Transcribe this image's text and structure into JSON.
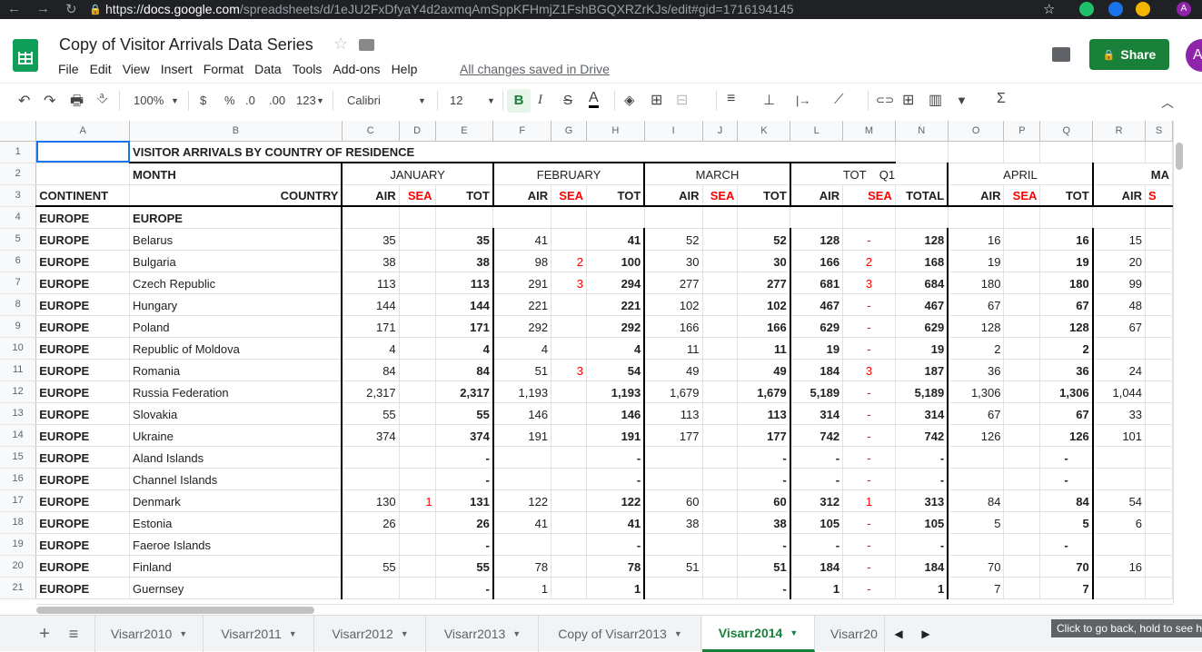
{
  "browser": {
    "url_scheme": "https://",
    "url_host": "docs.google.com",
    "url_path": "/spreadsheets/d/1eJU2FxDfyaY4d2axmqAmSppKFHmjZ1FshBGQXRZrKJs/edit#gid=1716194145",
    "back_icon": "←",
    "forward_icon": "→",
    "reload_icon": "↻",
    "lock_icon": "🔒",
    "star_icon": "☆",
    "profile": "A"
  },
  "app": {
    "title": "Copy of Visitor Arrivals Data Series",
    "star_icon": "☆",
    "menus": [
      "File",
      "Edit",
      "View",
      "Insert",
      "Format",
      "Data",
      "Tools",
      "Add-ons",
      "Help"
    ],
    "saved_status": "All changes saved in Drive",
    "share_label": "Share",
    "share_lock": "🔒",
    "avatar": "A"
  },
  "toolbar": {
    "undo": "↶",
    "redo": "↷",
    "print": "🖶",
    "paint": "⎀",
    "zoom": "100%",
    "currency": "$",
    "percent": "%",
    "dec_less": ".0",
    "dec_more": ".00",
    "format_more": "123",
    "font": "Calibri",
    "font_size": "12",
    "bold": "B",
    "italic": "I",
    "strike": "S",
    "text_color": "A",
    "fill": "◈",
    "borders": "⊞",
    "merge": "⊟",
    "align": "≡",
    "valign": "⊥",
    "wrap": "|→",
    "rotate": "⟋",
    "link": "⊂⊃",
    "comment": "⊞",
    "chart": "▥",
    "filter": "▼",
    "functions": "Σ",
    "collapse": "︿"
  },
  "columns": [
    "A",
    "B",
    "C",
    "D",
    "E",
    "F",
    "G",
    "H",
    "I",
    "J",
    "K",
    "L",
    "M",
    "N",
    "O",
    "P",
    "Q",
    "R",
    "S"
  ],
  "title_row": "VISITOR ARRIVALS BY COUNTRY OF RESIDENCE",
  "month_row": {
    "month": "MONTH",
    "jan": "JANUARY",
    "feb": "FEBRUARY",
    "mar": "MARCH",
    "q1": "TOT    Q1",
    "apr": "APRIL",
    "may": "MA"
  },
  "header_row": {
    "continent": "CONTINENT",
    "country": "COUNTRY",
    "air": "AIR",
    "sea": "SEA",
    "tot": "TOT",
    "total": "TOTAL",
    "sea_partial": "S"
  },
  "row4": {
    "continent": "EUROPE",
    "country": "EUROPE"
  },
  "rows": [
    [
      "EUROPE",
      "Belarus",
      "35",
      "",
      "35",
      "41",
      "",
      "41",
      "52",
      "",
      "52",
      "128",
      "-",
      "128",
      "16",
      "",
      "16",
      "15"
    ],
    [
      "EUROPE",
      "Bulgaria",
      "38",
      "",
      "38",
      "98",
      "2",
      "100",
      "30",
      "",
      "30",
      "166",
      "2",
      "168",
      "19",
      "",
      "19",
      "20"
    ],
    [
      "EUROPE",
      "Czech Republic",
      "113",
      "",
      "113",
      "291",
      "3",
      "294",
      "277",
      "",
      "277",
      "681",
      "3",
      "684",
      "180",
      "",
      "180",
      "99"
    ],
    [
      "EUROPE",
      "Hungary",
      "144",
      "",
      "144",
      "221",
      "",
      "221",
      "102",
      "",
      "102",
      "467",
      "-",
      "467",
      "67",
      "",
      "67",
      "48"
    ],
    [
      "EUROPE",
      "Poland",
      "171",
      "",
      "171",
      "292",
      "",
      "292",
      "166",
      "",
      "166",
      "629",
      "-",
      "629",
      "128",
      "",
      "128",
      "67"
    ],
    [
      "EUROPE",
      "Republic of Moldova",
      "4",
      "",
      "4",
      "4",
      "",
      "4",
      "11",
      "",
      "11",
      "19",
      "-",
      "19",
      "2",
      "",
      "2",
      ""
    ],
    [
      "EUROPE",
      "Romania",
      "84",
      "",
      "84",
      "51",
      "3",
      "54",
      "49",
      "",
      "49",
      "184",
      "3",
      "187",
      "36",
      "",
      "36",
      "24"
    ],
    [
      "EUROPE",
      "Russia Federation",
      "2,317",
      "",
      "2,317",
      "1,193",
      "",
      "1,193",
      "1,679",
      "",
      "1,679",
      "5,189",
      "-",
      "5,189",
      "1,306",
      "",
      "1,306",
      "1,044"
    ],
    [
      "EUROPE",
      "Slovakia",
      "55",
      "",
      "55",
      "146",
      "",
      "146",
      "113",
      "",
      "113",
      "314",
      "-",
      "314",
      "67",
      "",
      "67",
      "33"
    ],
    [
      "EUROPE",
      "Ukraine",
      "374",
      "",
      "374",
      "191",
      "",
      "191",
      "177",
      "",
      "177",
      "742",
      "-",
      "742",
      "126",
      "",
      "126",
      "101"
    ],
    [
      "EUROPE",
      "Aland Islands",
      "",
      "",
      "-",
      "",
      "",
      "-",
      "",
      "",
      "-",
      "-",
      "-",
      "-",
      "",
      "",
      "-",
      ""
    ],
    [
      "EUROPE",
      "Channel Islands",
      "",
      "",
      "-",
      "",
      "",
      "-",
      "",
      "",
      "-",
      "-",
      "-",
      "-",
      "",
      "",
      "-",
      ""
    ],
    [
      "EUROPE",
      "Denmark",
      "130",
      "1",
      "131",
      "122",
      "",
      "122",
      "60",
      "",
      "60",
      "312",
      "1",
      "313",
      "84",
      "",
      "84",
      "54"
    ],
    [
      "EUROPE",
      "Estonia",
      "26",
      "",
      "26",
      "41",
      "",
      "41",
      "38",
      "",
      "38",
      "105",
      "-",
      "105",
      "5",
      "",
      "5",
      "6"
    ],
    [
      "EUROPE",
      "Faeroe Islands",
      "",
      "",
      "-",
      "",
      "",
      "-",
      "",
      "",
      "-",
      "-",
      "-",
      "-",
      "",
      "",
      "-",
      ""
    ],
    [
      "EUROPE",
      "Finland",
      "55",
      "",
      "55",
      "78",
      "",
      "78",
      "51",
      "",
      "51",
      "184",
      "-",
      "184",
      "70",
      "",
      "70",
      "16"
    ],
    [
      "EUROPE",
      "Guernsey",
      "",
      "",
      "-",
      "1",
      "",
      "1",
      "",
      "",
      "-",
      "1",
      "-",
      "1",
      "7",
      "",
      "7",
      ""
    ]
  ],
  "sheet_tabs": [
    "Visarr2010",
    "Visarr2011",
    "Visarr2012",
    "Visarr2013",
    "Copy of Visarr2013",
    "Visarr2014",
    "Visarr20"
  ],
  "active_tab": "Visarr2014",
  "add_sheet": "+",
  "all_sheets": "≡",
  "tab_prev": "◀",
  "tab_next": "▶",
  "tooltip": "Click to go back, hold to see history",
  "colors": {
    "accent": "#188038",
    "selection": "#1a73e8",
    "sea_red": "#ff0000"
  }
}
